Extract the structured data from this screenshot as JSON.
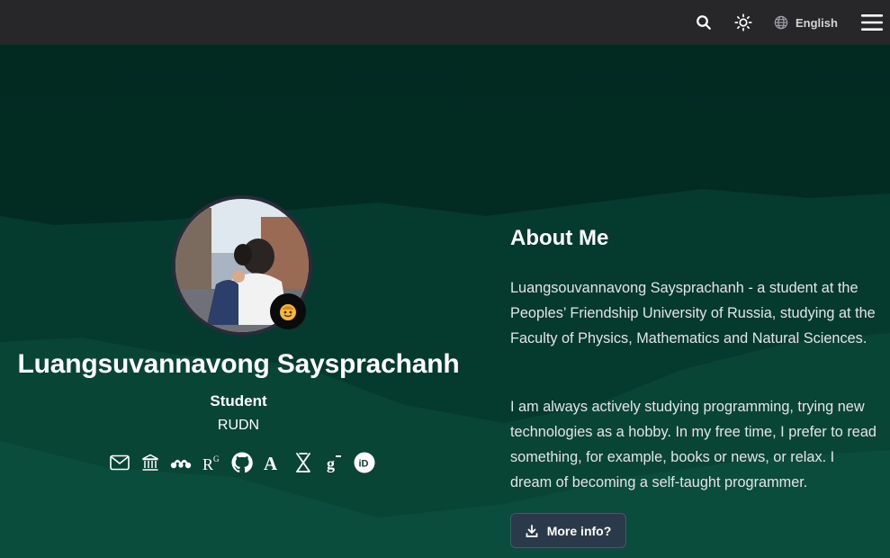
{
  "topbar": {
    "search_icon": "search-icon",
    "theme_icon": "sun-icon",
    "language_icon": "globe-icon",
    "language_label": "English",
    "menu_icon": "hamburger-menu-icon"
  },
  "profile": {
    "name": "Luangsuvannavong Saysprachanh",
    "role": "Student",
    "organization": "RUDN",
    "badge_icon": "emoji-badge-icon",
    "social_icons": [
      "email-icon",
      "institution-icon",
      "mendeley-icon",
      "researchgate-icon",
      "github-icon",
      "academia-icon",
      "scopus-icon",
      "google-scholar-icon",
      "orcid-icon"
    ]
  },
  "about": {
    "title": "About Me",
    "paragraph_1": "Luangsouvannavong Saysprachanh - a student at the Peoples’ Friendship University of Russia, studying at the Faculty of Physics, Mathematics and Natural Sciences.",
    "paragraph_2": "I am always actively studying programming, trying new technologies as a hobby. In my free time, I prefer to read something, for example, books or news, or relax. I dream of becoming a self-taught programmer.",
    "button_label": "More info?",
    "button_icon": "download-icon"
  },
  "colors": {
    "topbar": "#27272a",
    "hero_dark": "#032a22",
    "hero_mid": "#0a4434",
    "hero_light": "#0d5242"
  }
}
